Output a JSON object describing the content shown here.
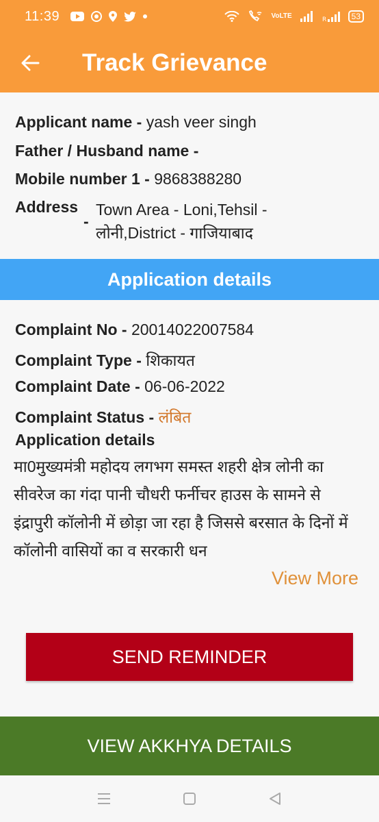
{
  "status_bar": {
    "time": "11:39",
    "volte_top": "Vo",
    "volte_bottom": "LTE",
    "battery": "53"
  },
  "app_bar": {
    "title": "Track Grievance"
  },
  "applicant": {
    "name_label": "Applicant name -",
    "name_value": "yash veer singh",
    "father_label": "Father / Husband name -",
    "father_value": "",
    "mobile_label": "Mobile number 1 -",
    "mobile_value": "9868388280",
    "address_label": "Address",
    "address_dash": "-",
    "address_value": "Town Area - Loni,Tehsil - लोनी,District - गाजियाबाद"
  },
  "section_header": "Application details",
  "complaint": {
    "no_label": "Complaint No -",
    "no_value": "20014022007584",
    "type_label": "Complaint Type -",
    "type_value": "शिकायत",
    "date_label": "Complaint Date -",
    "date_value": "06-06-2022",
    "status_label": "Complaint Status -",
    "status_value": "लंबित",
    "details_label": "Application details",
    "details_text": "मा0मुख्यमंत्री महोदय लगभग समस्त शहरी क्षेत्र लोनी का सीवरेज का गंदा पानी चौधरी फर्नीचर हाउस के सामने से इंद्रापुरी कॉलोनी में छोड़ा जा रहा है जिससे बरसात के दिनों में कॉलोनी वासियों का व सरकारी धन"
  },
  "view_more": "View More",
  "buttons": {
    "send_reminder": "SEND REMINDER",
    "view_akkhya": "VIEW AKKHYA DETAILS"
  },
  "colors": {
    "header_orange": "#f99b3a",
    "section_blue": "#42a5f5",
    "reminder_red": "#b30017",
    "akkhya_green": "#4b7a27",
    "accent_orange": "#d2772a"
  }
}
